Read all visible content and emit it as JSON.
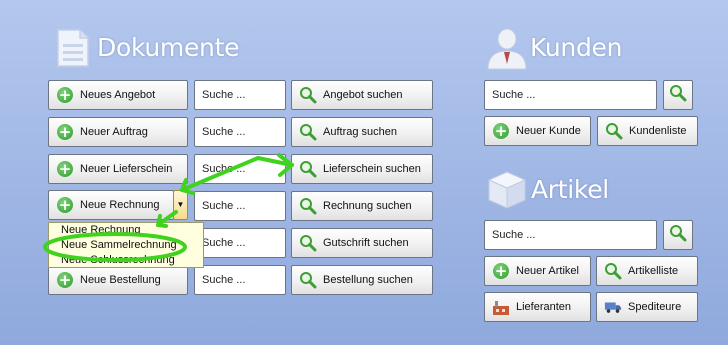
{
  "dokumente": {
    "title": "Dokumente",
    "rows": [
      {
        "button": "Neues Angebot",
        "search_placeholder": "Suche ...",
        "search_button": "Angebot suchen"
      },
      {
        "button": "Neuer Auftrag",
        "search_placeholder": "Suche ...",
        "search_button": "Auftrag suchen"
      },
      {
        "button": "Neuer Lieferschein",
        "search_placeholder": "Suche ...",
        "search_button": "Lieferschein suchen"
      },
      {
        "button": "Neue Rechnung",
        "search_placeholder": "Suche ...",
        "search_button": "Rechnung suchen"
      },
      {
        "button": "",
        "search_placeholder": "Suche ...",
        "search_button": "Gutschrift suchen"
      },
      {
        "button": "Neue Bestellung",
        "search_placeholder": "Suche ...",
        "search_button": "Bestellung suchen"
      }
    ],
    "rechnung_menu": [
      "Neue Rechnung",
      "Neue Sammelrechnung",
      "Neue Schlussrechnung"
    ]
  },
  "kunden": {
    "title": "Kunden",
    "search_placeholder": "Suche ...",
    "new_button": "Neuer Kunde",
    "list_button": "Kundenliste"
  },
  "artikel": {
    "title": "Artikel",
    "search_placeholder": "Suche ...",
    "new_button": "Neuer Artikel",
    "list_button": "Artikelliste",
    "suppliers_button": "Lieferanten",
    "carriers_button": "Spediteure"
  },
  "colors": {
    "annotation_green": "#3fd21e",
    "background": "#a3b9e6"
  }
}
